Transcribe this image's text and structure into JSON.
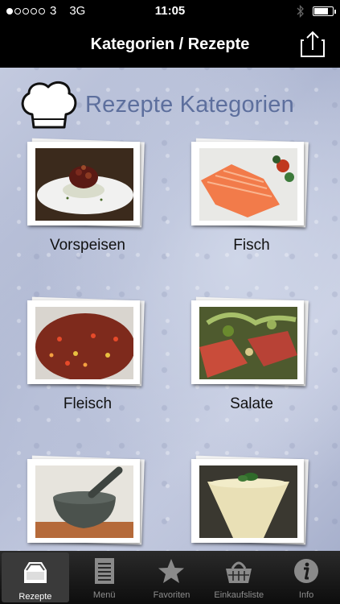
{
  "status_bar": {
    "carrier": "3",
    "network": "3G",
    "time": "11:05"
  },
  "nav": {
    "title": "Kategorien / Rezepte",
    "share_icon": "share-icon"
  },
  "header": {
    "title": "Rezepte Kategorien",
    "logo_icon": "chef-hat-icon",
    "accent_color": "#5d6f9d"
  },
  "categories": [
    {
      "label": "Vorspeisen"
    },
    {
      "label": "Fisch"
    },
    {
      "label": "Fleisch"
    },
    {
      "label": "Salate"
    },
    {
      "label": ""
    },
    {
      "label": ""
    }
  ],
  "tabs": [
    {
      "label": "Rezepte",
      "icon": "inbox-tray-icon",
      "active": true
    },
    {
      "label": "Menü",
      "icon": "list-icon",
      "active": false
    },
    {
      "label": "Favoriten",
      "icon": "star-icon",
      "active": false
    },
    {
      "label": "Einkaufsliste",
      "icon": "basket-icon",
      "active": false
    },
    {
      "label": "Info",
      "icon": "info-icon",
      "active": false
    }
  ]
}
